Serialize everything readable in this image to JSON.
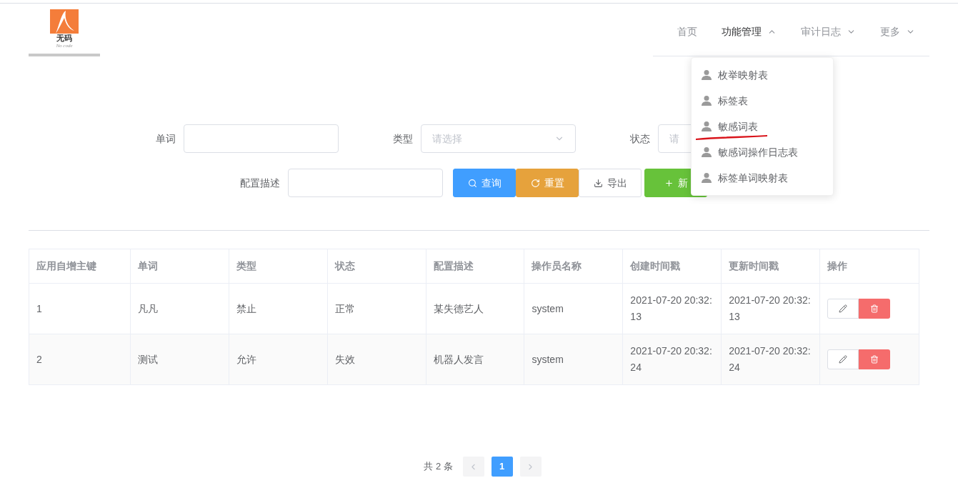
{
  "logo": {
    "title": "无码",
    "subtitle": "No code"
  },
  "nav": [
    {
      "label": "首页"
    },
    {
      "label": "功能管理",
      "expanded": true
    },
    {
      "label": "审计日志",
      "expanded": false
    },
    {
      "label": "更多",
      "expanded": false
    }
  ],
  "dropdown": {
    "items": [
      {
        "label": "枚举映射表",
        "marked": false
      },
      {
        "label": "标签表",
        "marked": false
      },
      {
        "label": "敏感词表",
        "marked": true
      },
      {
        "label": "敏感词操作日志表",
        "marked": false
      },
      {
        "label": "标签单词映射表",
        "marked": false
      }
    ]
  },
  "filters": [
    {
      "label": "单词",
      "kind": "input"
    },
    {
      "label": "类型",
      "kind": "select",
      "placeholder": "请选择",
      "caret": true
    },
    {
      "label": "状态",
      "kind": "select",
      "placeholder": "请"
    },
    {
      "label": "配置描述",
      "kind": "input"
    }
  ],
  "buttons": [
    {
      "label": "查询",
      "kind": "search"
    },
    {
      "label": "重置",
      "kind": "reset"
    },
    {
      "label": "导出",
      "kind": "export"
    },
    {
      "label": "新",
      "kind": "add"
    }
  ],
  "table": {
    "columns": [
      "应用自增主键",
      "单词",
      "类型",
      "状态",
      "配置描述",
      "操作员名称",
      "创建时间戳",
      "更新时间戳",
      "操作"
    ],
    "rows": [
      [
        "1",
        "凡凡",
        "禁止",
        "正常",
        "某失德艺人",
        "system",
        "2021-07-20 20:32:13",
        "2021-07-20 20:32:13"
      ],
      [
        "2",
        "测试",
        "允许",
        "失效",
        "机器人发言",
        "system",
        "2021-07-20 20:32:24",
        "2021-07-20 20:32:24"
      ]
    ]
  },
  "pagination": {
    "total": "共 2 条",
    "pages": [
      {
        "label": "1",
        "selected": true
      }
    ]
  }
}
